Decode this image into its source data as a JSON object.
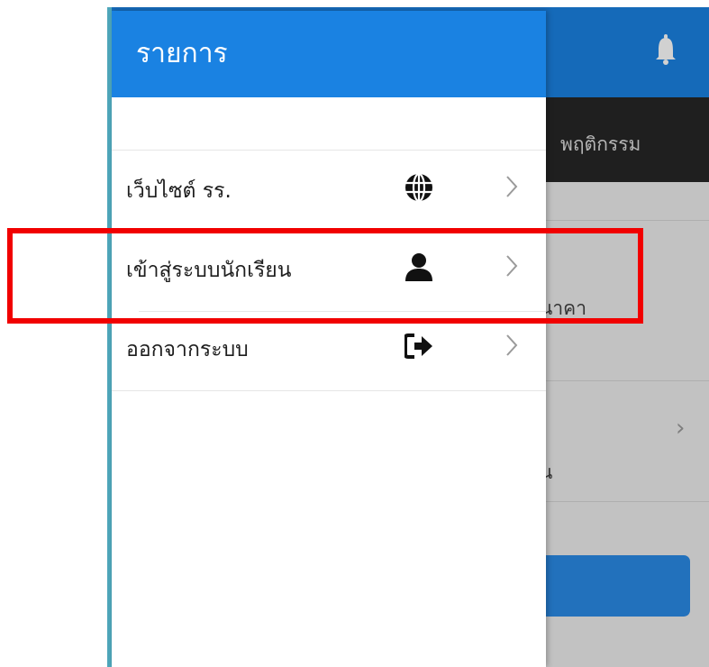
{
  "background": {
    "tab_label": "พฤติกรรม",
    "partial_text_1": "นาคา",
    "partial_text_2": "น",
    "icons": {
      "bell": "bell-icon",
      "chevron": "chevron-right-icon"
    }
  },
  "drawer": {
    "title": "รายการ",
    "items": [
      {
        "label": "เว็บไซต์ รร.",
        "icon": "globe-icon"
      },
      {
        "label": "เข้าสู่ระบบนักเรียน",
        "icon": "user-icon"
      },
      {
        "label": "ออกจากระบบ",
        "icon": "sign-out-icon"
      }
    ]
  },
  "colors": {
    "header_blue": "#1a82e2",
    "highlight_red": "#f10000",
    "tab_bar": "#262626"
  }
}
